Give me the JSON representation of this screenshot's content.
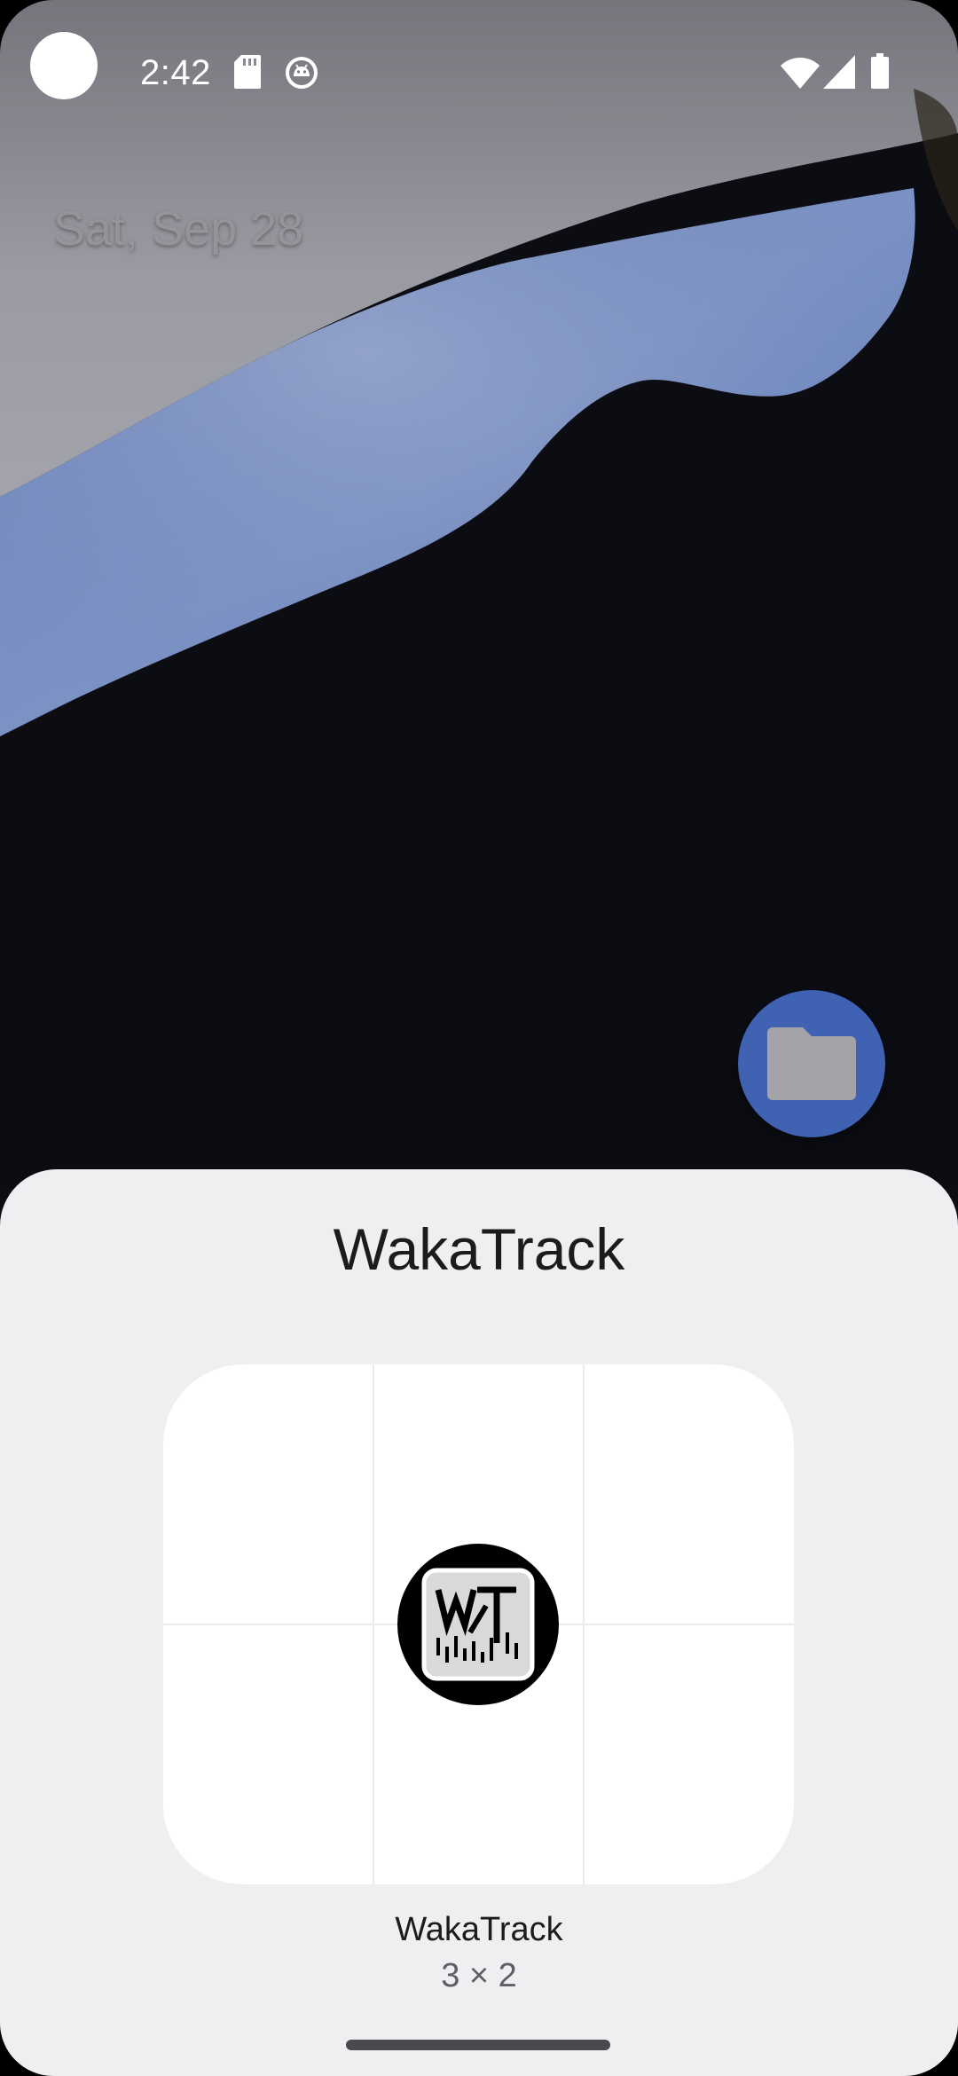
{
  "status_bar": {
    "time": "2:42",
    "icons": [
      "camera-cutout-icon",
      "sd-card-icon",
      "android-debug-icon",
      "wifi-icon",
      "cell-signal-icon",
      "battery-icon"
    ]
  },
  "home": {
    "date": "Sat, Sep 28",
    "folder_icon": "folder-icon"
  },
  "sheet": {
    "title": "WakaTrack",
    "widget": {
      "name": "WakaTrack",
      "size": "3 × 2",
      "icon": "wakatrack-logo-icon"
    }
  },
  "colors": {
    "sheet_background": "#efeff1",
    "folder_fab": "#3f62b3",
    "wallpaper_accent": "#5a78b8"
  }
}
